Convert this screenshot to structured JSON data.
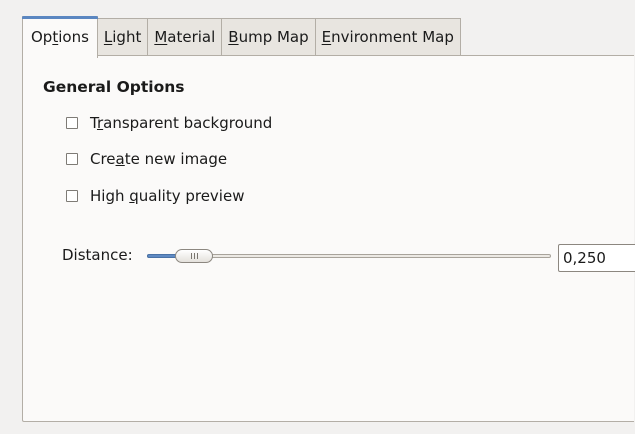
{
  "tabs": [
    {
      "id": "options",
      "label_pre": "Op",
      "label_mn": "t",
      "label_post": "ions",
      "active": true
    },
    {
      "id": "light",
      "label_pre": "",
      "label_mn": "L",
      "label_post": "ight",
      "active": false
    },
    {
      "id": "material",
      "label_pre": "",
      "label_mn": "M",
      "label_post": "aterial",
      "active": false
    },
    {
      "id": "bump-map",
      "label_pre": "",
      "label_mn": "B",
      "label_post": "ump Map",
      "active": false
    },
    {
      "id": "environment-map",
      "label_pre": "",
      "label_mn": "E",
      "label_post": "nvironment Map",
      "active": false
    }
  ],
  "section_title": "General Options",
  "checkboxes": [
    {
      "label_pre": "T",
      "label_mn": "r",
      "label_post": "ansparent background",
      "checked": false
    },
    {
      "label_pre": "Cre",
      "label_mn": "a",
      "label_post": "te new image",
      "checked": false
    },
    {
      "label_pre": "High ",
      "label_mn": "q",
      "label_post": "uality preview",
      "checked": false
    }
  ],
  "distance": {
    "label": "Distance:",
    "value": "0,250",
    "value_fraction": 0.25
  },
  "colors": {
    "accent": "#5b87c1",
    "slider_fill": "#5f8ac3",
    "background": "#f2f1f0",
    "panel": "#fbfaf9"
  },
  "icons": {
    "spin_up": "chevron-up-icon",
    "spin_down": "chevron-down-icon",
    "slider_grip": "grip-icon"
  }
}
